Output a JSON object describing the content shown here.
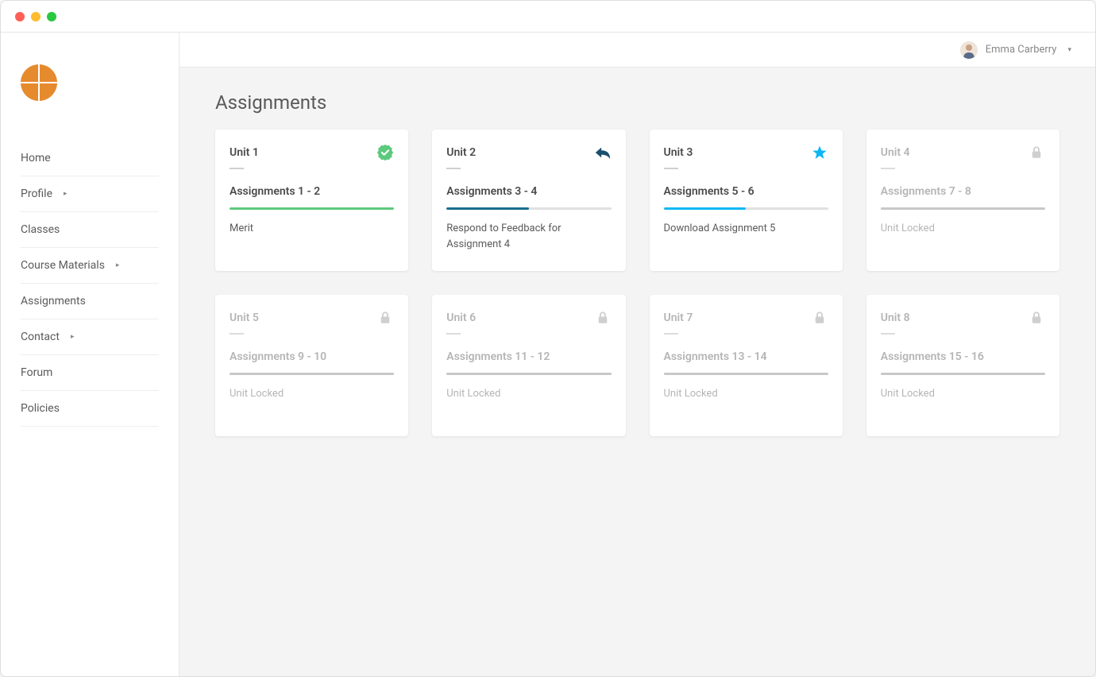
{
  "user": {
    "name": "Emma Carberry"
  },
  "sidebar": {
    "items": [
      {
        "label": "Home",
        "hasSubmenu": false
      },
      {
        "label": "Profile",
        "hasSubmenu": true
      },
      {
        "label": "Classes",
        "hasSubmenu": false
      },
      {
        "label": "Course Materials",
        "hasSubmenu": true
      },
      {
        "label": "Assignments",
        "hasSubmenu": false
      },
      {
        "label": "Contact",
        "hasSubmenu": true
      },
      {
        "label": "Forum",
        "hasSubmenu": false
      },
      {
        "label": "Policies",
        "hasSubmenu": false
      }
    ]
  },
  "page": {
    "title": "Assignments"
  },
  "cards": [
    {
      "unit": "Unit 1",
      "range": "Assignments 1 - 2",
      "status": "Merit",
      "icon": "checkmark-badge",
      "iconColor": "#5cc97d",
      "progress": 100,
      "progressColor": "#5cc97d",
      "locked": false
    },
    {
      "unit": "Unit 2",
      "range": "Assignments 3 - 4",
      "status": "Respond to Feedback for Assignment 4",
      "icon": "reply",
      "iconColor": "#1a4f6e",
      "progress": 50,
      "progressColor": "#1a6d8e",
      "locked": false
    },
    {
      "unit": "Unit 3",
      "range": "Assignments 5 - 6",
      "status": "Download Assignment 5",
      "icon": "star",
      "iconColor": "#0eb7f4",
      "progress": 50,
      "progressColor": "#0eb7f4",
      "locked": false
    },
    {
      "unit": "Unit 4",
      "range": "Assignments 7 - 8",
      "status": "Unit Locked",
      "icon": "lock",
      "iconColor": "#cfcfcf",
      "progress": 100,
      "progressColor": "#c8c8c8",
      "locked": true
    },
    {
      "unit": "Unit 5",
      "range": "Assignments 9 - 10",
      "status": "Unit Locked",
      "icon": "lock",
      "iconColor": "#cfcfcf",
      "progress": 100,
      "progressColor": "#c8c8c8",
      "locked": true
    },
    {
      "unit": "Unit 6",
      "range": "Assignments 11 - 12",
      "status": "Unit Locked",
      "icon": "lock",
      "iconColor": "#cfcfcf",
      "progress": 100,
      "progressColor": "#c8c8c8",
      "locked": true
    },
    {
      "unit": "Unit 7",
      "range": "Assignments 13 - 14",
      "status": "Unit Locked",
      "icon": "lock",
      "iconColor": "#cfcfcf",
      "progress": 100,
      "progressColor": "#c8c8c8",
      "locked": true
    },
    {
      "unit": "Unit 8",
      "range": "Assignments 15 - 16",
      "status": "Unit Locked",
      "icon": "lock",
      "iconColor": "#cfcfcf",
      "progress": 100,
      "progressColor": "#c8c8c8",
      "locked": true
    }
  ]
}
